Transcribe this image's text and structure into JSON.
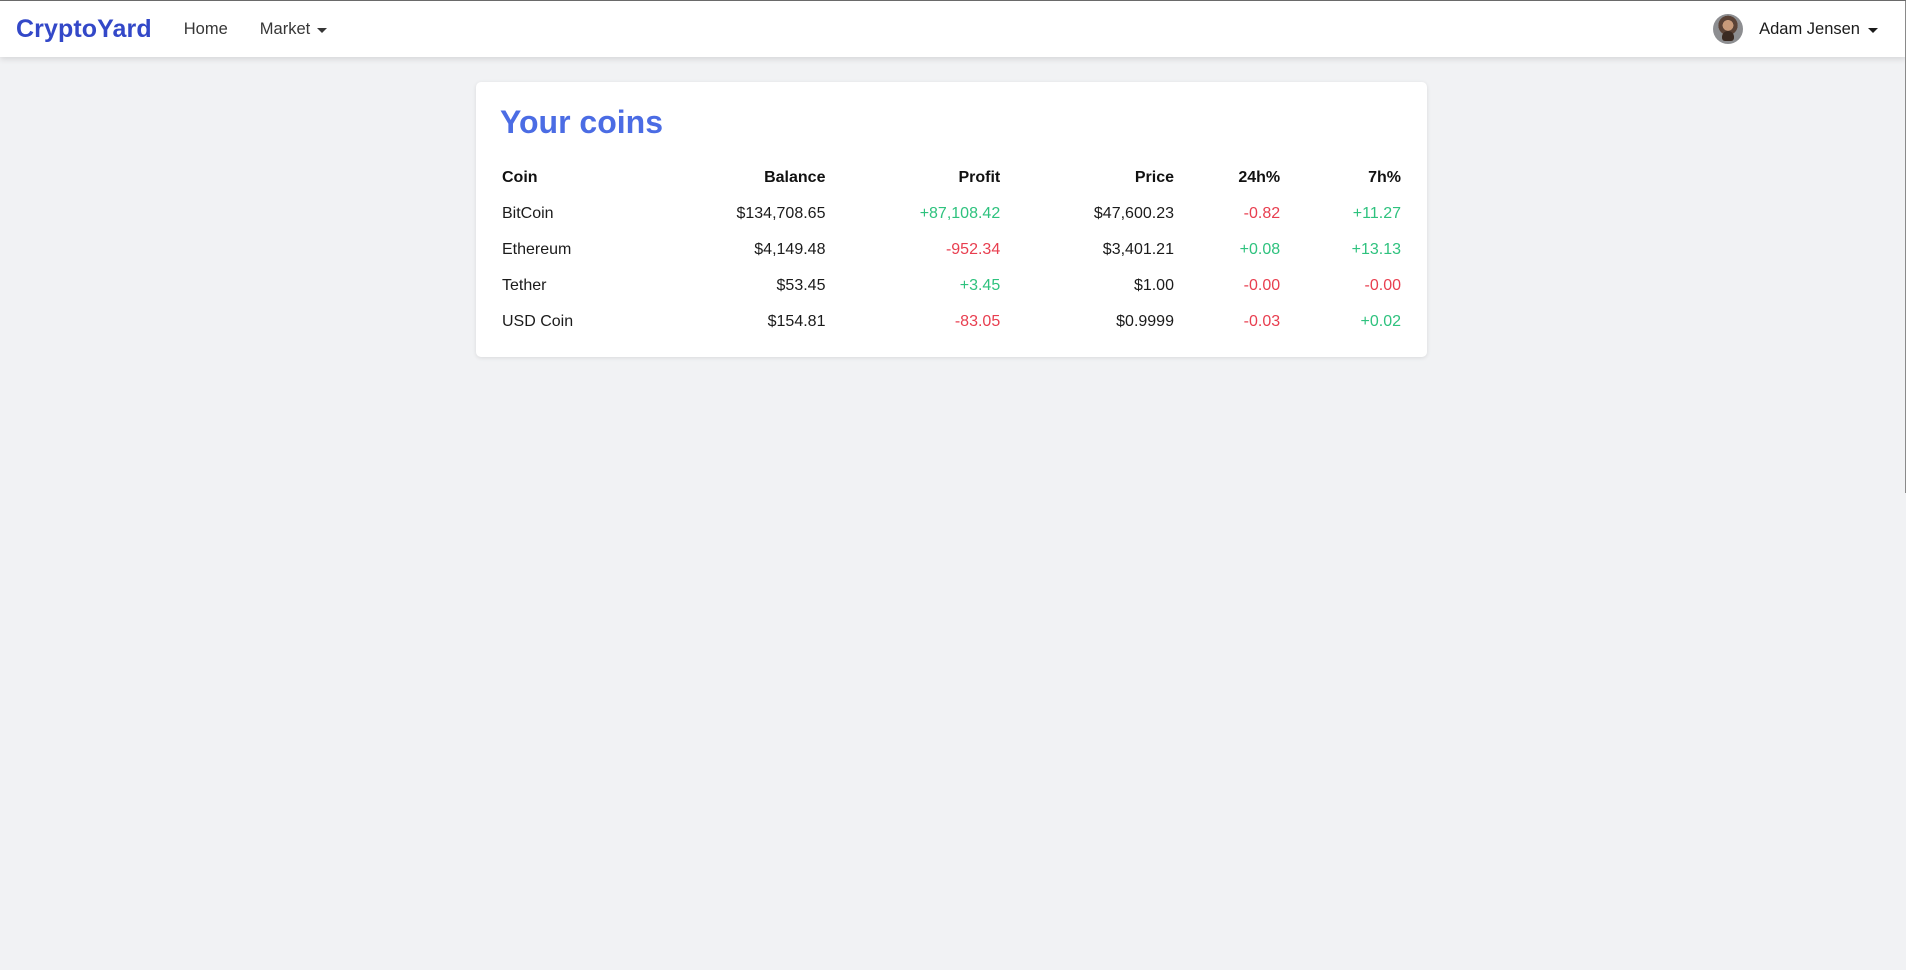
{
  "navbar": {
    "brand": "CryptoYard",
    "links": [
      {
        "label": "Home"
      },
      {
        "label": "Market"
      }
    ],
    "user": {
      "name": "Adam Jensen"
    }
  },
  "main": {
    "title": "Your coins",
    "columns": [
      "Coin",
      "Balance",
      "Profit",
      "Price",
      "24h%",
      "7h%"
    ],
    "rows": [
      {
        "coin": "BitCoin",
        "balance": "$134,708.65",
        "profit": "+87,108.42",
        "price": "$47,600.23",
        "change_24h": "-0.82",
        "change_7h": "+11.27"
      },
      {
        "coin": "Ethereum",
        "balance": "$4,149.48",
        "profit": "-952.34",
        "price": "$3,401.21",
        "change_24h": "+0.08",
        "change_7h": "+13.13"
      },
      {
        "coin": "Tether",
        "balance": "$53.45",
        "profit": "+3.45",
        "price": "$1.00",
        "change_24h": "-0.00",
        "change_7h": "-0.00"
      },
      {
        "coin": "USD Coin",
        "balance": "$154.81",
        "profit": "-83.05",
        "price": "$0.9999",
        "change_24h": "-0.03",
        "change_7h": "+0.02"
      }
    ]
  },
  "colors": {
    "brand": "#3348c8",
    "title": "#4b6ce4",
    "positive": "#2ec27e",
    "negative": "#e83e4f",
    "background": "#f1f2f4"
  },
  "icons": {
    "market_dropdown": "chevron-down-icon",
    "user_dropdown": "chevron-down-icon",
    "avatar": "user-avatar-icon"
  }
}
